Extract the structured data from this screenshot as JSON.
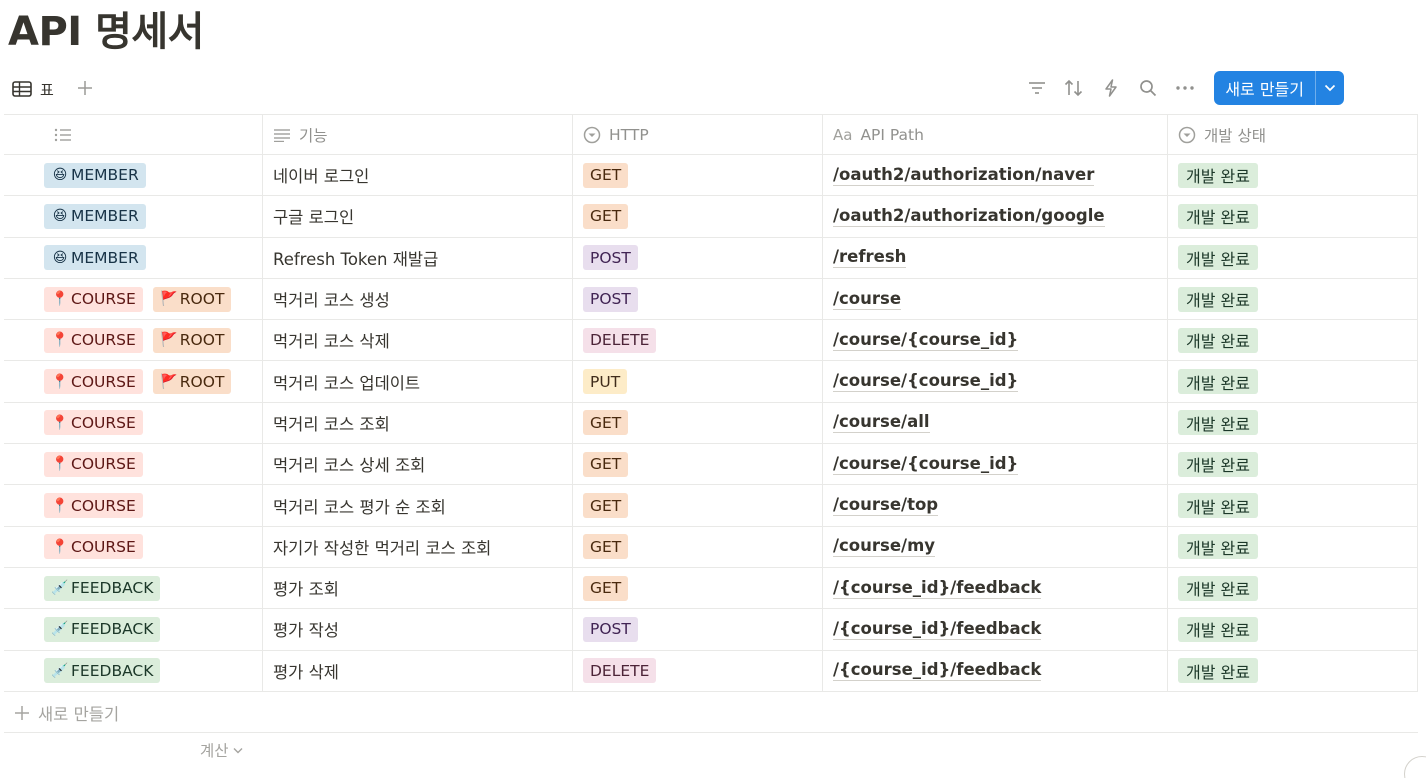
{
  "page": {
    "title": "API 명세서"
  },
  "view": {
    "tab_label": "표"
  },
  "toolbar": {
    "new_label": "새로 만들기"
  },
  "columns": {
    "c1": "",
    "c2": "기능",
    "c3": "HTTP",
    "c4": "API Path",
    "c5": "개발 상태"
  },
  "colors": {
    "accent": "#2383e2",
    "member_tag": "#d3e5ef",
    "course_tag": "#ffe2dd",
    "root_tag": "#fadec9",
    "feedback_tag": "#dbeddb",
    "status_done": "#dbeddb"
  },
  "rows": [
    {
      "tags": [
        {
          "label": "MEMBER",
          "icon": "grinning-face-icon",
          "kind": "member"
        }
      ],
      "feature": "네이버 로그인",
      "method": "GET",
      "path": "/oauth2/authorization/naver",
      "status": "개발 완료"
    },
    {
      "tags": [
        {
          "label": "MEMBER",
          "icon": "grinning-face-icon",
          "kind": "member"
        }
      ],
      "feature": "구글 로그인",
      "method": "GET",
      "path": "/oauth2/authorization/google",
      "status": "개발 완료"
    },
    {
      "tags": [
        {
          "label": "MEMBER",
          "icon": "grinning-face-icon",
          "kind": "member"
        }
      ],
      "feature": "Refresh Token 재발급",
      "method": "POST",
      "path": "/refresh",
      "status": "개발 완료"
    },
    {
      "tags": [
        {
          "label": "COURSE",
          "icon": "pushpin-icon",
          "kind": "course"
        },
        {
          "label": "ROOT",
          "icon": "red-flag-icon",
          "kind": "root"
        }
      ],
      "feature": "먹거리 코스 생성",
      "method": "POST",
      "path": "/course",
      "status": "개발 완료"
    },
    {
      "tags": [
        {
          "label": "COURSE",
          "icon": "pushpin-icon",
          "kind": "course"
        },
        {
          "label": "ROOT",
          "icon": "red-flag-icon",
          "kind": "root"
        }
      ],
      "feature": "먹거리 코스 삭제",
      "method": "DELETE",
      "path": "/course/{course_id}",
      "status": "개발 완료"
    },
    {
      "tags": [
        {
          "label": "COURSE",
          "icon": "pushpin-icon",
          "kind": "course"
        },
        {
          "label": "ROOT",
          "icon": "red-flag-icon",
          "kind": "root"
        }
      ],
      "feature": "먹거리 코스 업데이트",
      "method": "PUT",
      "path": "/course/{course_id}",
      "status": "개발 완료"
    },
    {
      "tags": [
        {
          "label": "COURSE",
          "icon": "pushpin-icon",
          "kind": "course"
        }
      ],
      "feature": "먹거리 코스 조회",
      "method": "GET",
      "path": "/course/all",
      "status": "개발 완료"
    },
    {
      "tags": [
        {
          "label": "COURSE",
          "icon": "pushpin-icon",
          "kind": "course"
        }
      ],
      "feature": "먹거리 코스 상세 조회",
      "method": "GET",
      "path": "/course/{course_id}",
      "status": "개발 완료"
    },
    {
      "tags": [
        {
          "label": "COURSE",
          "icon": "pushpin-icon",
          "kind": "course"
        }
      ],
      "feature": "먹거리 코스 평가 순 조회",
      "method": "GET",
      "path": "/course/top",
      "status": "개발 완료"
    },
    {
      "tags": [
        {
          "label": "COURSE",
          "icon": "pushpin-icon",
          "kind": "course"
        }
      ],
      "feature": "자기가 작성한 먹거리 코스 조회",
      "method": "GET",
      "path": "/course/my",
      "status": "개발 완료"
    },
    {
      "tags": [
        {
          "label": "FEEDBACK",
          "icon": "syringe-icon",
          "kind": "feedback"
        }
      ],
      "feature": "평가 조회",
      "method": "GET",
      "path": "/{course_id}/feedback",
      "status": "개발 완료"
    },
    {
      "tags": [
        {
          "label": "FEEDBACK",
          "icon": "syringe-icon",
          "kind": "feedback"
        }
      ],
      "feature": "평가 작성",
      "method": "POST",
      "path": "/{course_id}/feedback",
      "status": "개발 완료"
    },
    {
      "tags": [
        {
          "label": "FEEDBACK",
          "icon": "syringe-icon",
          "kind": "feedback"
        }
      ],
      "feature": "평가 삭제",
      "method": "DELETE",
      "path": "/{course_id}/feedback",
      "status": "개발 완료"
    }
  ],
  "footer": {
    "add_label": "새로 만들기",
    "calc_label": "계산"
  }
}
